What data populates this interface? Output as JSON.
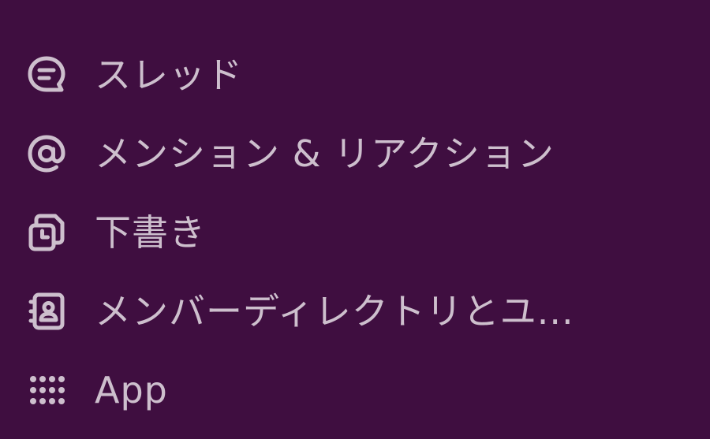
{
  "sidebar": {
    "items": [
      {
        "icon": "threads-icon",
        "label": "スレッド"
      },
      {
        "icon": "at-sign-icon",
        "label": "メンション & リアクション"
      },
      {
        "icon": "drafts-icon",
        "label": "下書き"
      },
      {
        "icon": "member-directory-icon",
        "label": "メンバーディレクトリとユ..."
      },
      {
        "icon": "apps-grid-icon",
        "label": "App"
      }
    ]
  },
  "colors": {
    "background": "#3f0e40",
    "text": "#cdbfcd",
    "icon": "#cdbfcd"
  }
}
